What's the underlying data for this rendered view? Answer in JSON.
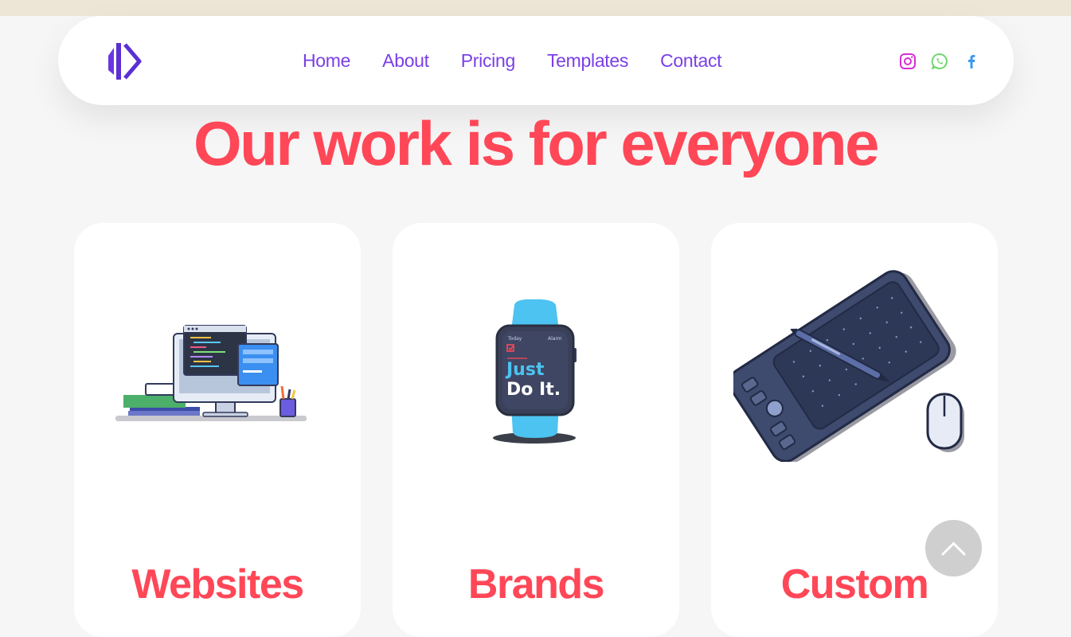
{
  "nav": {
    "links": [
      "Home",
      "About",
      "Pricing",
      "Templates",
      "Contact"
    ],
    "accent_color": "#7a3fe6",
    "social": [
      {
        "icon": "instagram-icon",
        "color": "#d62fd6"
      },
      {
        "icon": "whatsapp-icon",
        "color": "#6fd66a"
      },
      {
        "icon": "facebook-icon",
        "color": "#3b99f0"
      }
    ]
  },
  "hero": {
    "headline": "Our work is for everyone",
    "color": "#ff4757"
  },
  "cards": [
    {
      "title": "Websites",
      "icon": "computer-desk-illustration"
    },
    {
      "title": "Brands",
      "icon": "smartwatch-illustration",
      "watch_text": [
        "Just",
        "Do It."
      ]
    },
    {
      "title": "Custom",
      "icon": "drawing-tablet-illustration"
    }
  ],
  "scroll_top": {
    "icon": "chevron-up-icon"
  }
}
